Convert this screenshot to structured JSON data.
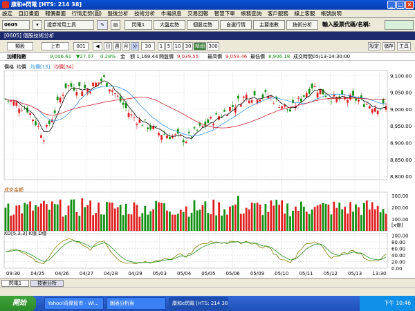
{
  "window": {
    "title": "康和e閃電 [HTS: 214 38]"
  },
  "menu": [
    "設定",
    "自訂畫面",
    "報價畫面",
    "行情走勢(圖)",
    "盤後分析",
    "技術分析",
    "市場訊息",
    "交易回報",
    "智慧下單",
    "帳務查詢",
    "客戶服務",
    "線上客服",
    "帳號說明"
  ],
  "toolbar": {
    "code": "0605",
    "tool_select": "證券常用工具",
    "buttons": [
      "閃電1",
      "大盤走勢",
      "個股走勢",
      "自選行情",
      "主要指數",
      "技術分析"
    ],
    "search_label": "輸入股票代碼/名稱:",
    "search_value": ""
  },
  "panel": {
    "title": "[0605] 個股技術分析",
    "right_buttons": [
      "設定",
      "儲存",
      "工具"
    ]
  },
  "controls": {
    "market_type": "類股",
    "market": "上市",
    "code": "001",
    "periods": [
      "日",
      "週",
      "月",
      "分"
    ],
    "minutes": "30",
    "ranges": [
      "1",
      "5",
      "10",
      "30",
      "精細",
      "300"
    ]
  },
  "info": {
    "name": "加權指數",
    "price": "9,006.61",
    "change": "▼27.07",
    "pct": "0.28%",
    "amount_label": "金",
    "amount": "額 1,169.44",
    "open_label": "開盤價",
    "open": "9,039.55",
    "high_label": "最高價",
    "high": "9,059.46",
    "low_label": "最低價",
    "low": "8,906.18",
    "time_label": "成交時間",
    "time": "05/13-14:30:00"
  },
  "price_legend": {
    "label": "價格",
    "ma1": "均價",
    "ma2": "均價[13]",
    "ma3": "均價[34]"
  },
  "volume_legend": "成交金額",
  "volume_unit": "[x億]",
  "kd_legend": "KD[5,3,3]  K值  D值",
  "chart_data": {
    "type": "candlestick",
    "title": "",
    "x_ticks": [
      "09:30",
      "04/25",
      "04/26",
      "04/27",
      "04/28",
      "04/29",
      "05/03",
      "05/04",
      "05/05",
      "05/06",
      "05/09",
      "05/10",
      "05/11",
      "05/12",
      "05/13",
      "13:30"
    ],
    "price_axis": [
      "9,100.00",
      "9,050.00",
      "9,000.00",
      "8,950.00",
      "8,900.00",
      "8,850.00",
      "8,800.00"
    ],
    "price_range": [
      8790,
      9115
    ],
    "volume_axis": [
      "300.00",
      "200.00",
      "100.00"
    ],
    "volume_range": [
      0,
      330
    ],
    "kd_axis": [
      "100.00",
      "80.00",
      "60.00",
      "40.00",
      "20.00",
      "0.00"
    ],
    "kd_range": [
      0,
      105
    ],
    "colors": {
      "up": "#e02020",
      "down": "#109010",
      "ma1": "#000000",
      "ma2": "#3090e0",
      "ma3": "#d02030"
    }
  }
}
